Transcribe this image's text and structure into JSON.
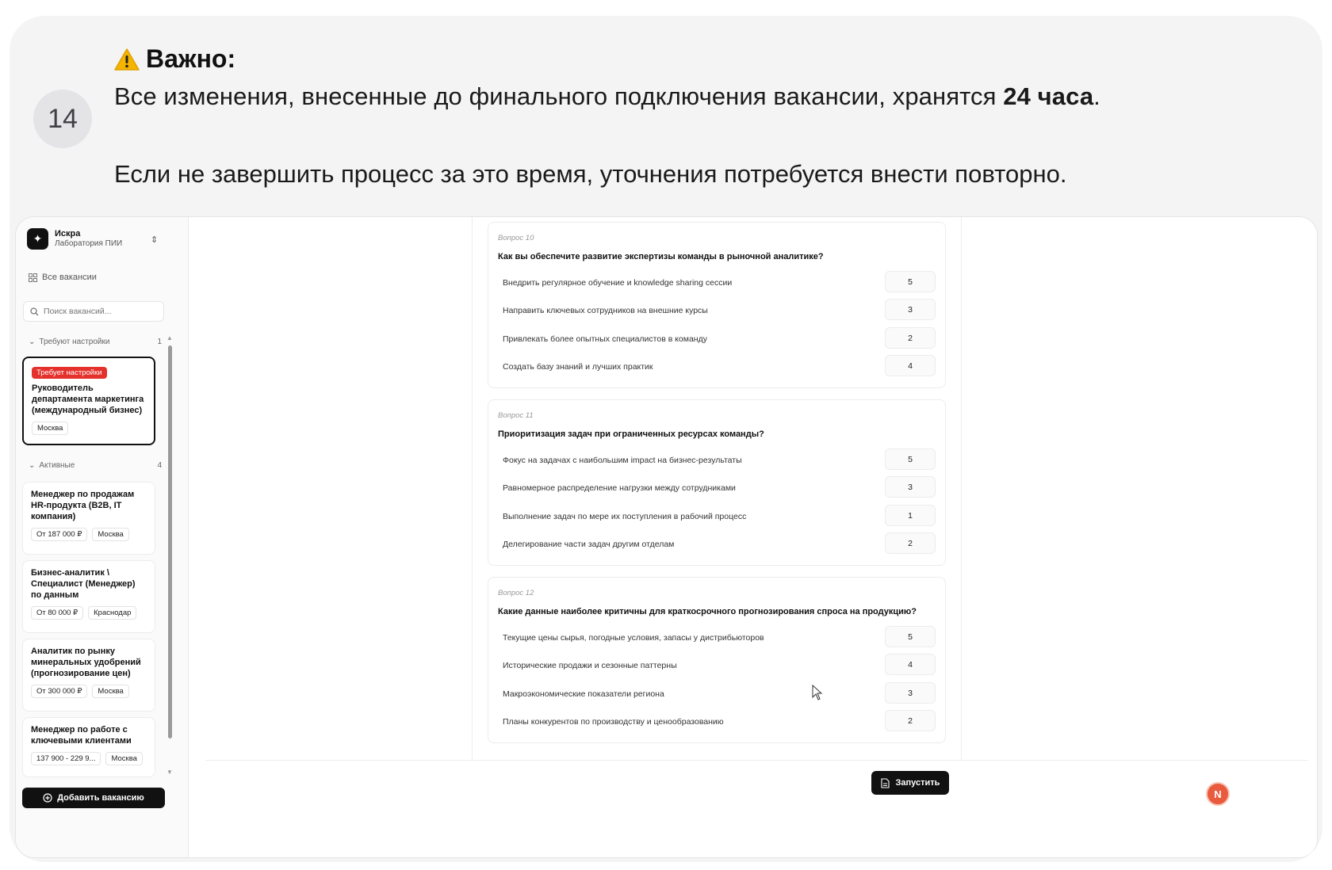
{
  "step_number": "14",
  "warning": {
    "title": "Важно:",
    "line1_prefix": "Все изменения, внесенные до финального подключения вакансии, хранятся ",
    "line1_bold": "24 часа",
    "line1_suffix": ".",
    "line2": "Если не завершить процесс за это время, уточнения потребуется внести повторно."
  },
  "sidebar": {
    "brand_name": "Искра",
    "brand_sub": "Лаборатория ПИИ",
    "all_vacancies": "Все вакансии",
    "search_placeholder": "Поиск вакансий...",
    "group_setup": {
      "label": "Требуют настройки",
      "count": "1"
    },
    "group_active": {
      "label": "Активные",
      "count": "4"
    },
    "setup_card": {
      "badge": "Требует настройки",
      "title": "Руководитель департамента маркетинга (международный бизнес)",
      "tags": [
        "Москва"
      ]
    },
    "active_cards": [
      {
        "title": "Менеджер по продажам HR-продукта (B2B, IT компания)",
        "tags": [
          "От 187 000 ₽",
          "Москва"
        ]
      },
      {
        "title": "Бизнес-аналитик \\ Специалист (Менеджер) по данным",
        "tags": [
          "От 80 000 ₽",
          "Краснодар"
        ]
      },
      {
        "title": "Аналитик по рынку минеральных удобрений (прогнозирование цен)",
        "tags": [
          "От 300 000 ₽",
          "Москва"
        ]
      },
      {
        "title": "Менеджер по работе с ключевыми клиентами",
        "tags": [
          "137 900 - 229 9...",
          "Москва"
        ]
      }
    ],
    "add_button": "Добавить вакансию"
  },
  "questions": [
    {
      "num": "Вопрос 10",
      "title": "Как вы обеспечите развитие экспертизы команды в рыночной аналитике?",
      "options": [
        {
          "text": "Внедрить регулярное обучение и knowledge sharing сессии",
          "score": "5"
        },
        {
          "text": "Направить ключевых сотрудников на внешние курсы",
          "score": "3"
        },
        {
          "text": "Привлекать более опытных специалистов в команду",
          "score": "2"
        },
        {
          "text": "Создать базу знаний и лучших практик",
          "score": "4"
        }
      ]
    },
    {
      "num": "Вопрос 11",
      "title": "Приоритизация задач при ограниченных ресурсах команды?",
      "options": [
        {
          "text": "Фокус на задачах с наибольшим impact на бизнес-результаты",
          "score": "5"
        },
        {
          "text": "Равномерное распределение нагрузки между сотрудниками",
          "score": "3"
        },
        {
          "text": "Выполнение задач по мере их поступления в рабочий процесс",
          "score": "1"
        },
        {
          "text": "Делегирование части задач другим отделам",
          "score": "2"
        }
      ]
    },
    {
      "num": "Вопрос 12",
      "title": "Какие данные наиболее критичны для краткосрочного прогнозирования спроса на продукцию?",
      "options": [
        {
          "text": "Текущие цены сырья, погодные условия, запасы у дистрибьюторов",
          "score": "5"
        },
        {
          "text": "Исторические продажи и сезонные паттерны",
          "score": "4"
        },
        {
          "text": "Макроэкономические показатели региона",
          "score": "3"
        },
        {
          "text": "Планы конкурентов по производству и ценообразованию",
          "score": "2"
        }
      ]
    }
  ],
  "run_button": "Запустить",
  "avatar_letter": "N",
  "colors": {
    "badge_red": "#e5312b",
    "dark": "#111111",
    "avatar": "#ea5a3d",
    "warning_yellow": "#f5b400"
  }
}
